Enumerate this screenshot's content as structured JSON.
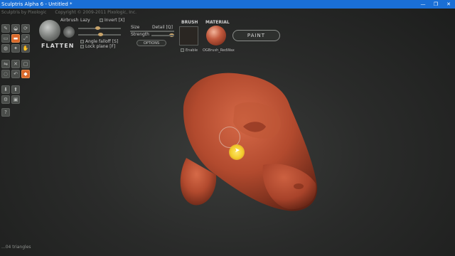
{
  "window": {
    "title": "Sculptris Alpha 6 - Untitled *",
    "minimize": "—",
    "restore": "❐",
    "close": "✕"
  },
  "menu_line": {
    "app": "Sculptris by Pixologic",
    "copyright": "Copyright © 2009-2011 Pixologic, Inc."
  },
  "brush": {
    "name": "FLATTEN",
    "airbrush_label": "Airbrush",
    "lazy_label": "Lazy",
    "invert_label": "Invert [X]",
    "size_label": "Size",
    "detail_label": "Detail [Q]",
    "strength_label": "Strength",
    "angle_falloff_label": "Angle falloff [S]",
    "lock_plane_label": "Lock plane [F]",
    "options_label": "OPTIONS",
    "brush_section": "BRUSH",
    "enable_label": "Enable",
    "material_section": "MATERIAL",
    "material_name": "OGBrush_RedWax",
    "paint_label": "PAINT"
  },
  "status": {
    "triangles": "...04 triangles"
  },
  "colors": {
    "titlebar": "#1a6fd6",
    "active_tool": "#d9682a",
    "model": "#b24a2e",
    "cursor": "#f2cc2a"
  }
}
